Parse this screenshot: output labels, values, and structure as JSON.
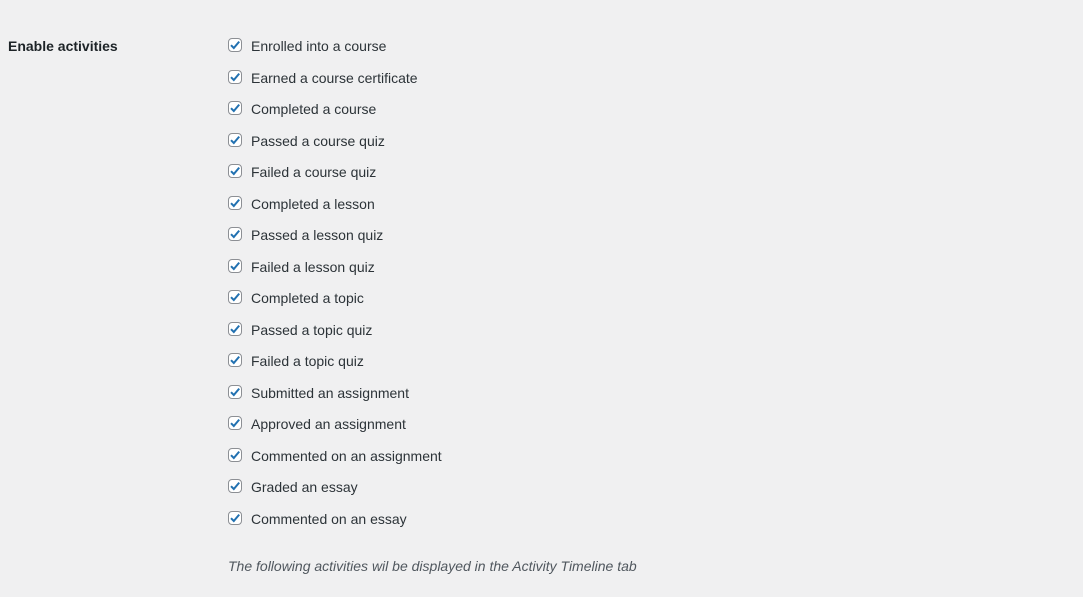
{
  "section": {
    "label": "Enable activities",
    "description": "The following activities wil be displayed in the Activity Timeline tab"
  },
  "colors": {
    "accent": "#2271b1",
    "text": "#2c3338",
    "background": "#f0f0f1"
  },
  "activities": [
    {
      "label": "Enrolled into a course",
      "checked": true
    },
    {
      "label": "Earned a course certificate",
      "checked": true
    },
    {
      "label": "Completed a course",
      "checked": true
    },
    {
      "label": "Passed a course quiz",
      "checked": true
    },
    {
      "label": "Failed a course quiz",
      "checked": true
    },
    {
      "label": "Completed a lesson",
      "checked": true
    },
    {
      "label": "Passed a lesson quiz",
      "checked": true
    },
    {
      "label": "Failed a lesson quiz",
      "checked": true
    },
    {
      "label": "Completed a topic",
      "checked": true
    },
    {
      "label": "Passed a topic quiz",
      "checked": true
    },
    {
      "label": "Failed a topic quiz",
      "checked": true
    },
    {
      "label": "Submitted an assignment",
      "checked": true
    },
    {
      "label": "Approved an assignment",
      "checked": true
    },
    {
      "label": "Commented on an assignment",
      "checked": true
    },
    {
      "label": "Graded an essay",
      "checked": true
    },
    {
      "label": "Commented on an essay",
      "checked": true
    }
  ]
}
